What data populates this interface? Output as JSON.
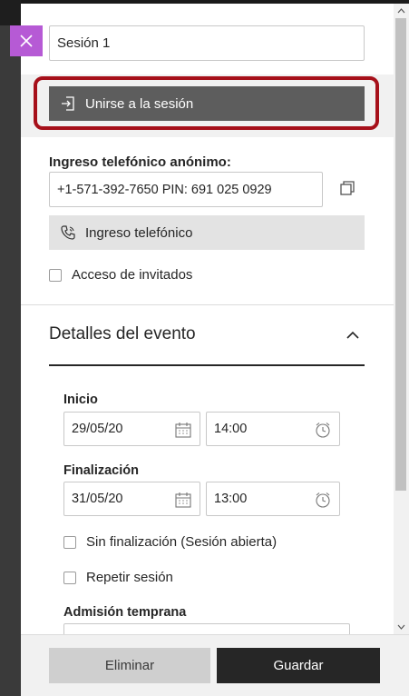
{
  "session": {
    "name": "Sesión 1",
    "join_label": "Unirse a la sesión"
  },
  "phone": {
    "label": "Ingreso telefónico anónimo:",
    "number": "+1-571-392-7650 PIN: 691 025 0929",
    "button_label": "Ingreso telefónico"
  },
  "guest_access": {
    "label": "Acceso de invitados",
    "checked": false
  },
  "event_details": {
    "title": "Detalles del evento",
    "start": {
      "label": "Inicio",
      "date": "29/05/20",
      "time": "14:00"
    },
    "end": {
      "label": "Finalización",
      "date": "31/05/20",
      "time": "13:00"
    },
    "no_end_label": "Sin finalización (Sesión abierta)",
    "repeat_label": "Repetir sesión",
    "early_admission_label": "Admisión temprana"
  },
  "footer": {
    "delete_label": "Eliminar",
    "save_label": "Guardar"
  },
  "colors": {
    "accent_close": "#b65ad5",
    "highlight": "#a6101a",
    "join_button": "#5d5d5d",
    "save_button": "#262626"
  }
}
